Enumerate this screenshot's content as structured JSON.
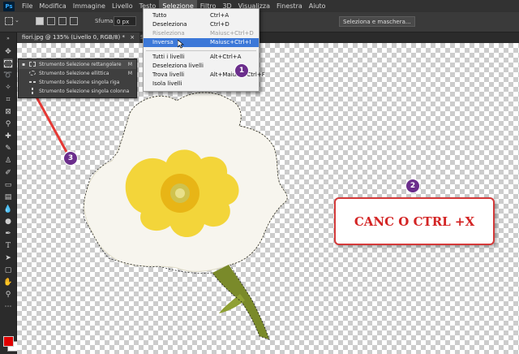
{
  "menubar": {
    "logo": "Ps",
    "items": [
      "File",
      "Modifica",
      "Immagine",
      "Livello",
      "Testo",
      "Selezione",
      "Filtro",
      "3D",
      "Visualizza",
      "Finestra",
      "Aiuto"
    ]
  },
  "options_bar": {
    "feather_label": "Sfuma:",
    "feather_value": "0 px",
    "select_mask_button": "Seleziona e maschera..."
  },
  "document_tab": {
    "title": "fiori.jpg @ 135% (Livello 0, RGB/8) *",
    "close": "×",
    "next_tab": "Se"
  },
  "selection_menu": {
    "items": [
      {
        "label": "Tutto",
        "shortcut": "Ctrl+A"
      },
      {
        "label": "Deseleziona",
        "shortcut": "Ctrl+D"
      },
      {
        "label": "Riseleziona",
        "shortcut": "Maiusc+Ctrl+D"
      },
      {
        "label": "Inversa",
        "shortcut": "Maiusc+Ctrl+I"
      },
      {
        "label": "Tutti i livelli",
        "shortcut": "Alt+Ctrl+A"
      },
      {
        "label": "Deseleziona livelli",
        "shortcut": ""
      },
      {
        "label": "Trova livelli",
        "shortcut": "Alt+Maiusc+Ctrl+F"
      },
      {
        "label": "Isola livelli",
        "shortcut": ""
      }
    ]
  },
  "marquee_flyout": {
    "items": [
      {
        "label": "Strumento Selezione rettangolare",
        "key": "M"
      },
      {
        "label": "Strumento Selezione ellittica",
        "key": "M"
      },
      {
        "label": "Strumento Selezione singola riga",
        "key": ""
      },
      {
        "label": "Strumento Selezione singola colonna",
        "key": ""
      }
    ]
  },
  "annotation": {
    "text": "CANC O CTRL +X",
    "badges": [
      "1",
      "2",
      "3"
    ]
  },
  "colors": {
    "menu_highlight": "#3c78d8",
    "annotation_red": "#d32424",
    "badge_purple": "#6b2e8c",
    "foreground_color": "#e00000",
    "background_color": "#ffffff"
  }
}
